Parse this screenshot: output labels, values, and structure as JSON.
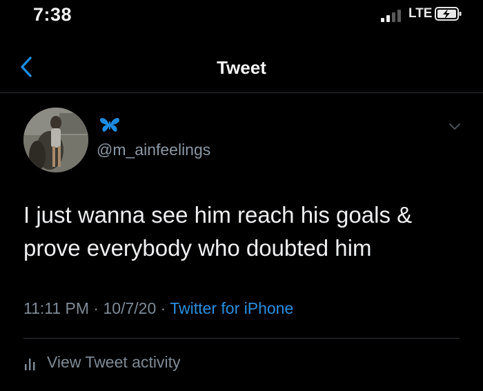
{
  "status_bar": {
    "time": "7:38",
    "network": "LTE",
    "signal_bars_active": 2,
    "signal_bars_total": 4,
    "battery_icon": "battery-charging-icon"
  },
  "nav": {
    "back_icon": "chevron-left-icon",
    "title": "Tweet"
  },
  "tweet": {
    "avatar_icon": "avatar",
    "display_name_icon": "butterfly-icon",
    "handle": "@m_ainfeelings",
    "text": "I just wanna see him reach his goals &\nprove everybody who doubted him",
    "time": "11:11 PM",
    "date": "10/7/20",
    "source": "Twitter for iPhone",
    "separator": " · "
  },
  "actions": {
    "activity_label": "View Tweet activity",
    "activity_icon": "bar-chart-icon"
  },
  "colors": {
    "background": "#000000",
    "link": "#2a8fe0",
    "secondary_text": "#7f8b96",
    "primary_text": "#eef0f1"
  }
}
